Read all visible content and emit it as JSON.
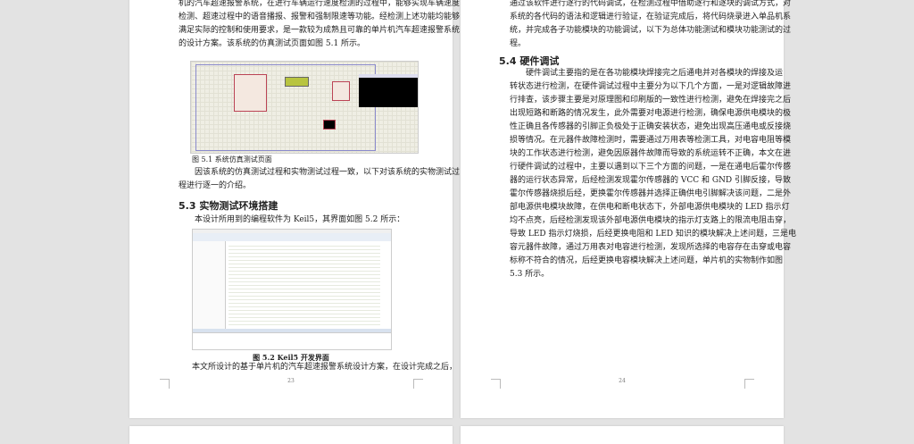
{
  "page23": {
    "intro_lines": [
      "机的汽车超速报警系统，在进行车辆运行速度检测的过程中，能够实现车辆速度",
      "检测、超速过程中的语音播报、报警和强制限速等功能。经检测上述功能均能够",
      "满足实际的控制和使用要求，是一款较为成熟且可靠的单片机汽车超速报警系统",
      "的设计方案。该系统的仿真测试页面如图 5.1 所示。"
    ],
    "figure1_caption": "图 5.1 系统仿真测试页面",
    "para2_lines": [
      "因该系统的仿真测试过程和实物测试过程一致，以下对该系统的实物测试过",
      "程进行逐一的介绍。"
    ],
    "section_heading": "5.3 实物测试环境搭建",
    "para3": "本设计所用到的编程软件为 Keil5，其界面如图 5.2 所示：",
    "figure2_caption": "图 5.2 Keil5 开发界面",
    "para4": "本文所设计的基于单片机的汽车超速报警系统设计方案，在设计完成之后，",
    "page_number": "23"
  },
  "page24": {
    "intro_lines": [
      "通过该软件进行逐行的代码调试，在检测过程中借助逐行和逐块的调试方式，对",
      "系统的各代码的语法和逻辑进行验证，在验证完成后，将代码烧录进入单品机系",
      "统，并完成各子功能模块的功能调试，以下为总体功能测试和模块功能测试的过",
      "程。"
    ],
    "section_heading": "5.4 硬件调试",
    "para_lines": [
      "硬件调试主要指的是在各功能模块焊接完之后通电并对各模块的焊接及运",
      "转状态进行检测，在硬件调试过程中主要分为以下几个方面，一是对逻辑故障进",
      "行排查，该步骤主要是对原理图和印刷版的一致性进行检测，避免在焊接完之后",
      "出现短路和断路的情况发生，此外需要对电源进行检测，确保电源供电模块的极",
      "性正确且各传感器的引脚正负极处于正确安装状态，避免出现高压通电或反接烧",
      "损等情况。在元器件故障检测时，需要通过万用表等检测工具，对电容电阻等模",
      "块的工作状态进行检测，避免因原器件故障而导致的系统运转不正确，本文在进",
      "行硬件调试的过程中，主要以遇到以下三个方面的问题，一是在通电后霍尔传感",
      "器的运行状态异常，后经检测发现霍尔传感器的 VCC 和 GND 引脚反接，导致",
      "霍尔传感器烧损后经，更换霍尔传感器并选择正确供电引脚解决该问题，二是外",
      "部电源供电模块故障，在供电和断电状态下，外部电源供电模块的 LED 指示灯",
      "均不点亮，后经检测发现该外部电源供电模块的指示灯支路上的限流电阻击穿，",
      "导致 LED 指示灯烧损，后经更换电阻和 LED 知识的模块解决上述问题，三是电",
      "容元器件故障，通过万用表对电容进行检测，发现所选择的电容存在击穿或电容",
      "标称不符合的情况，后经更换电容模块解决上述问题，单片机的实物制作如图",
      "5.3 所示。"
    ],
    "page_number": "24"
  },
  "colors": {
    "background": "#e3e3e3",
    "page": "#ffffff",
    "text": "#222222"
  }
}
